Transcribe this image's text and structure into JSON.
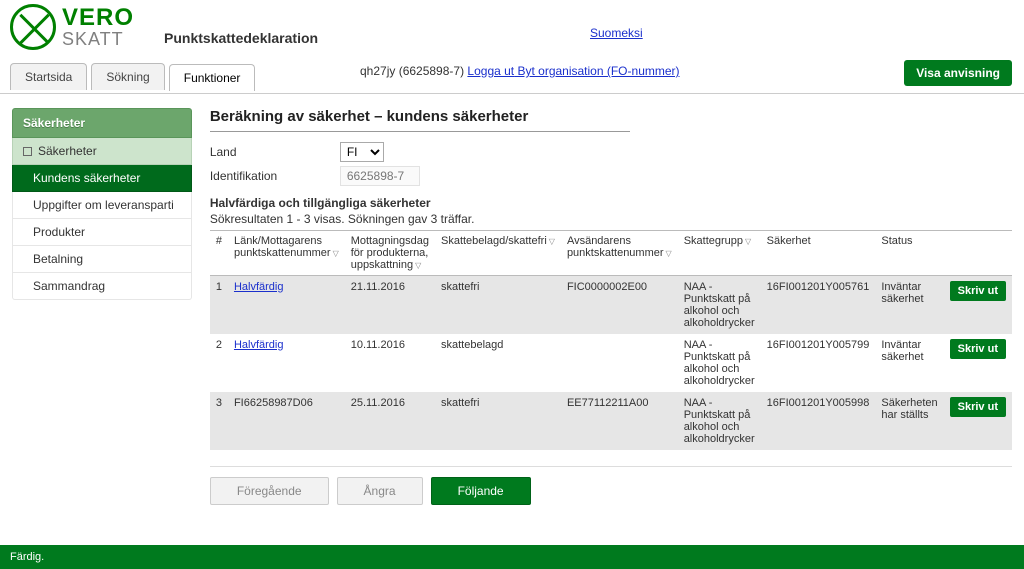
{
  "logo": {
    "line1": "VERO",
    "line2": "SKATT"
  },
  "app_title": "Punktskattedeklaration",
  "lang_link": "Suomeksi",
  "tabs": {
    "start": "Startsida",
    "search": "Sökning",
    "funktioner": "Funktioner"
  },
  "user": {
    "prefix": "qh27jy (6625898-7) ",
    "logout": "Logga ut",
    "switch": " Byt organisation (FO-nummer)"
  },
  "visa_anvisning": "Visa anvisning",
  "sidebar": {
    "header": "Säkerheter",
    "root": "Säkerheter",
    "items": [
      "Kundens säkerheter",
      "Uppgifter om leveransparti",
      "Produkter",
      "Betalning",
      "Sammandrag"
    ]
  },
  "page_title": "Beräkning av säkerhet – kundens säkerheter",
  "fields": {
    "land_label": "Land",
    "land_value": "FI",
    "ident_label": "Identifikation",
    "ident_value": "6625898-7"
  },
  "section_title": "Halvfärdiga och tillgängliga säkerheter",
  "results_note": "Sökresultaten 1 - 3 visas. Sökningen gav 3 träffar.",
  "columns": {
    "num": "#",
    "link": "Länk/Mottagarens punktskattenummer",
    "date": "Mottagningsdag för produkterna, uppskattning",
    "tax": "Skattebelagd/skattefri",
    "sender": "Avsändarens punktskattenummer",
    "group": "Skattegrupp",
    "security": "Säkerhet",
    "status": "Status"
  },
  "rows": [
    {
      "n": "1",
      "link": "Halvfärdig",
      "date": "21.11.2016",
      "tax": "skattefri",
      "sender": "FIC0000002E00",
      "group": "NAA - Punktskatt på alkohol och alkoholdrycker",
      "security": "16FI001201Y005761",
      "status": "Inväntar säkerhet"
    },
    {
      "n": "2",
      "link": "Halvfärdig",
      "date": "10.11.2016",
      "tax": "skattebelagd",
      "sender": "",
      "group": "NAA - Punktskatt på alkohol och alkoholdrycker",
      "security": "16FI001201Y005799",
      "status": "Inväntar säkerhet"
    },
    {
      "n": "3",
      "link": "FI66258987D06",
      "date": "25.11.2016",
      "tax": "skattefri",
      "sender": "EE77112211A00",
      "group": "NAA - Punktskatt på alkohol och alkoholdrycker",
      "security": "16FI001201Y005998",
      "status": "Säkerheten har ställts"
    }
  ],
  "buttons": {
    "print": "Skriv ut",
    "prev": "Föregående",
    "undo": "Ångra",
    "next": "Följande"
  },
  "footer": "Färdig."
}
